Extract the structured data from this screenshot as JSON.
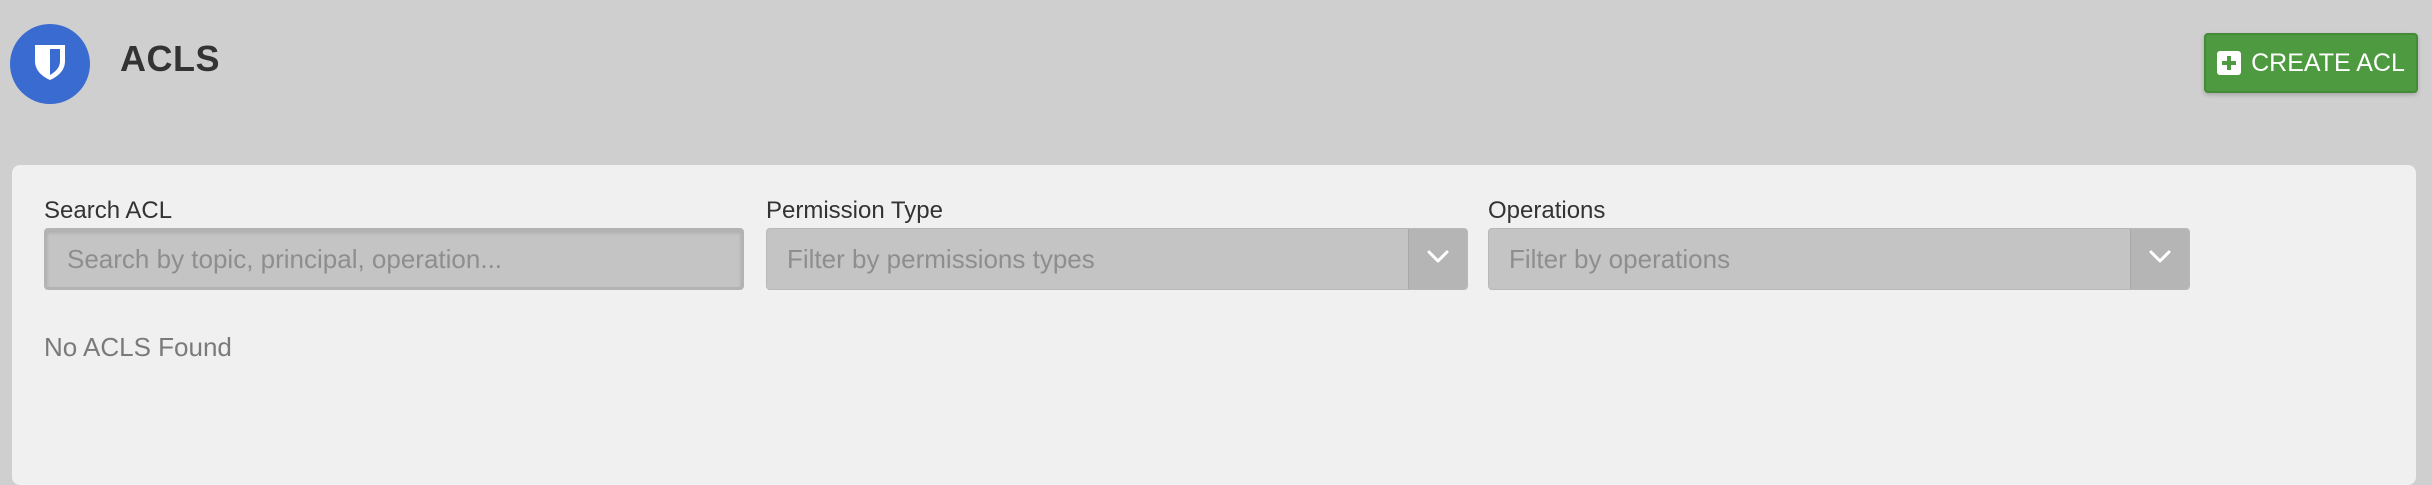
{
  "header": {
    "title": "ACLS",
    "logo_icon": "shield-icon",
    "create_button_label": "CREATE ACL",
    "create_button_icon": "plus-square-icon",
    "accent_color": "#3a6bd0",
    "button_color": "#4e9a40"
  },
  "filters": {
    "search": {
      "label": "Search ACL",
      "placeholder": "Search by topic, principal, operation...",
      "value": ""
    },
    "permission_type": {
      "label": "Permission Type",
      "placeholder": "Filter by permissions types"
    },
    "operations": {
      "label": "Operations",
      "placeholder": "Filter by operations"
    }
  },
  "results": {
    "empty_message": "No ACLS Found"
  }
}
